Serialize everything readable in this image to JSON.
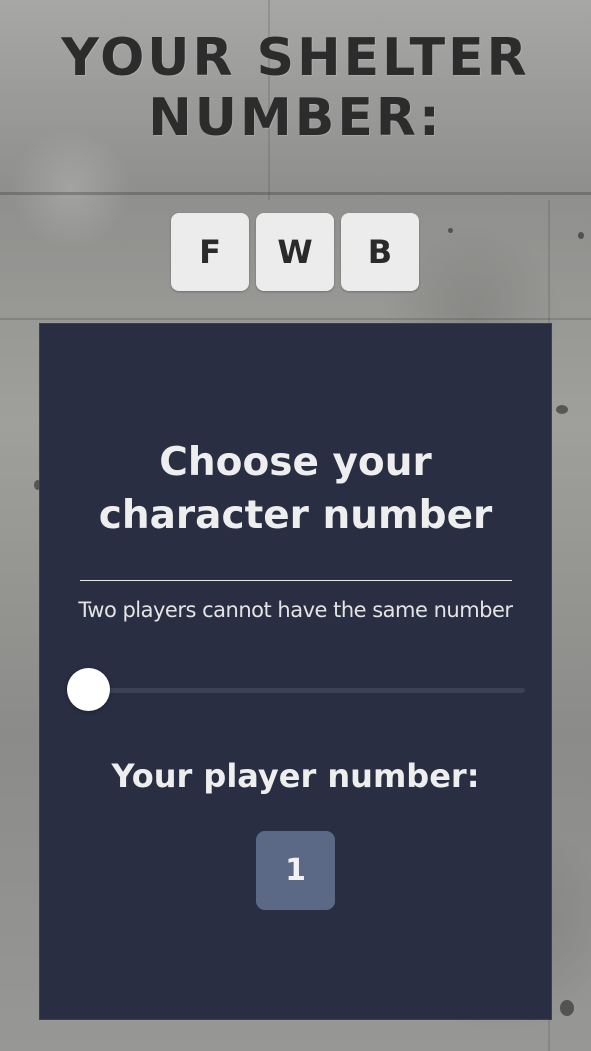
{
  "shelter": {
    "title_line1": "YOUR SHELTER",
    "title_line2": "NUMBER:",
    "letters": [
      "F",
      "W",
      "B"
    ]
  },
  "panel": {
    "heading_line1": "Choose your",
    "heading_line2": "character number",
    "hint": "Two players cannot have the same number",
    "slider": {
      "value_fraction": 0.0
    },
    "player_label": "Your player number:",
    "player_number": "1"
  },
  "colors": {
    "panel_bg": "#292e42",
    "number_box_bg": "#5b6987",
    "letter_box_bg": "#ececec",
    "title_text": "#2c2c2c"
  }
}
